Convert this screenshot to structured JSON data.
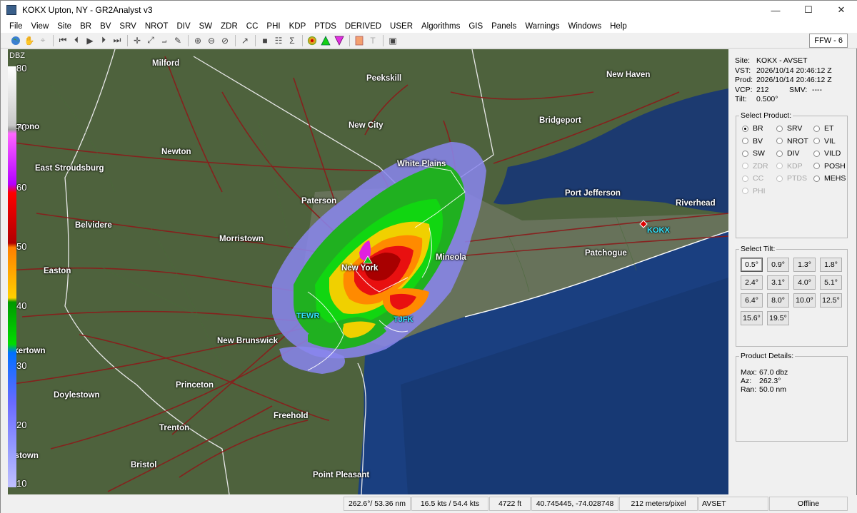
{
  "window": {
    "title": "KOKX Upton, NY - GR2Analyst v3",
    "minimize_icon": "minimize-icon",
    "maximize_icon": "maximize-icon",
    "close_icon": "close-icon"
  },
  "menu": [
    "File",
    "View",
    "Site",
    "BR",
    "BV",
    "SRV",
    "NROT",
    "DIV",
    "SW",
    "ZDR",
    "CC",
    "PHI",
    "KDP",
    "PTDS",
    "DERIVED",
    "USER",
    "Algorithms",
    "GIS",
    "Panels",
    "Warnings",
    "Windows",
    "Help"
  ],
  "toolbar": {
    "icons": [
      "globe-icon",
      "hand-icon",
      "sampling-icon",
      "first-frame-icon",
      "prev-frame-icon",
      "play-icon",
      "next-frame-icon",
      "last-frame-icon",
      "pan-icon",
      "cross-section-icon",
      "measure-icon",
      "pencil-icon",
      "zoom-in-icon",
      "zoom-out-icon",
      "zoom-reset-icon",
      "arrow-icon",
      "black-square-icon",
      "grid-icon",
      "sigma-icon",
      "hail-icon",
      "green-triangle-icon",
      "magenta-triangle-icon",
      "orange-square-icon",
      "text-icon",
      "frame-icon"
    ],
    "ffw_label": "FFW - 6"
  },
  "colorbar": {
    "unit": "DBZ",
    "ticks": [
      "80",
      "70",
      "60",
      "50",
      "40",
      "30",
      "20",
      "10"
    ]
  },
  "map": {
    "cities": [
      {
        "name": "Milford"
      },
      {
        "name": "Peekskill"
      },
      {
        "name": "New Haven"
      },
      {
        "name": "Pocono"
      },
      {
        "name": "New City"
      },
      {
        "name": "Bridgeport"
      },
      {
        "name": "Newton"
      },
      {
        "name": "White Plains"
      },
      {
        "name": "East Stroudsburg"
      },
      {
        "name": "Paterson"
      },
      {
        "name": "Port Jefferson"
      },
      {
        "name": "Riverhead"
      },
      {
        "name": "Belvidere"
      },
      {
        "name": "Morristown"
      },
      {
        "name": "Patchogue"
      },
      {
        "name": "Mineola"
      },
      {
        "name": "New York"
      },
      {
        "name": "Easton"
      },
      {
        "name": "New Brunswick"
      },
      {
        "name": "akertown"
      },
      {
        "name": "Doylestown"
      },
      {
        "name": "Princeton"
      },
      {
        "name": "Freehold"
      },
      {
        "name": "Trenton"
      },
      {
        "name": "ristown"
      },
      {
        "name": "Bristol"
      },
      {
        "name": "Point Pleasant"
      }
    ],
    "stations": [
      {
        "name": "KOKX"
      },
      {
        "name": "TEWR"
      },
      {
        "name": "TJFK"
      }
    ]
  },
  "site_info": {
    "site_label": "Site:",
    "site": "KOKX - AVSET",
    "vst_label": "VST:",
    "vst": "2026/10/14  20:46:12 Z",
    "prod_label": "Prod:",
    "prod": "2026/10/14  20:46:12 Z",
    "vcp_label": "VCP:",
    "vcp": "212",
    "smv_label": "SMV:",
    "smv": "----",
    "tilt_label": "Tilt:",
    "tilt": "0.500°"
  },
  "select_product": {
    "title": "Select Product:",
    "products": [
      {
        "label": "BR",
        "selected": true,
        "enabled": true
      },
      {
        "label": "SRV",
        "selected": false,
        "enabled": true
      },
      {
        "label": "ET",
        "selected": false,
        "enabled": true
      },
      {
        "label": "BV",
        "selected": false,
        "enabled": true
      },
      {
        "label": "NROT",
        "selected": false,
        "enabled": true
      },
      {
        "label": "VIL",
        "selected": false,
        "enabled": true
      },
      {
        "label": "SW",
        "selected": false,
        "enabled": true
      },
      {
        "label": "DIV",
        "selected": false,
        "enabled": true
      },
      {
        "label": "VILD",
        "selected": false,
        "enabled": true
      },
      {
        "label": "ZDR",
        "selected": false,
        "enabled": false
      },
      {
        "label": "KDP",
        "selected": false,
        "enabled": false
      },
      {
        "label": "POSH",
        "selected": false,
        "enabled": true
      },
      {
        "label": "CC",
        "selected": false,
        "enabled": false
      },
      {
        "label": "PTDS",
        "selected": false,
        "enabled": false
      },
      {
        "label": "MEHS",
        "selected": false,
        "enabled": true
      },
      {
        "label": "PHI",
        "selected": false,
        "enabled": false
      }
    ]
  },
  "select_tilt": {
    "title": "Select Tilt:",
    "tilts": [
      "0.5°",
      "0.9°",
      "1.3°",
      "1.8°",
      "2.4°",
      "3.1°",
      "4.0°",
      "5.1°",
      "6.4°",
      "8.0°",
      "10.0°",
      "12.5°",
      "15.6°",
      "19.5°"
    ],
    "active": "0.5°"
  },
  "product_details": {
    "title": "Product Details:",
    "max_label": "Max:",
    "max": "67.0 dbz",
    "az_label": "Az:",
    "az": "262.3°",
    "ran_label": "Ran:",
    "ran": "50.0 nm"
  },
  "statusbar": {
    "azimuth_range": "262.6°/ 53.36 nm",
    "speed": "16.5 kts / 54.4 kts",
    "height": "4722 ft",
    "coords": "40.745445, -74.028748",
    "resolution": "212 meters/pixel",
    "mode": "AVSET",
    "connection": "Offline"
  }
}
